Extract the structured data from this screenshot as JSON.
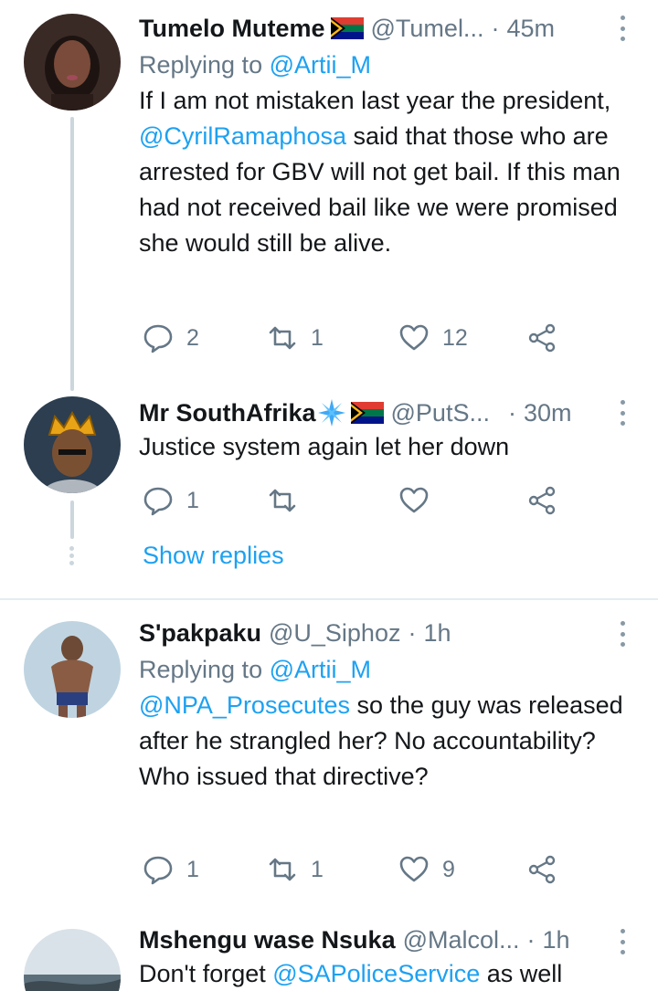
{
  "tweets": [
    {
      "name": "Tumelo Muteme",
      "handle": "@Tumel...",
      "sep": "·",
      "time": "45m",
      "reply_prefix": "Replying to ",
      "reply_to": "@Artii_M",
      "text_parts": [
        "If I am not mistaken last year the president, ",
        "@CyrilRamaphosa",
        " said that those who are arrested for GBV will not get bail. If this man had not received bail like we were promised she would still be alive."
      ],
      "replies": "2",
      "retweets": "1",
      "likes": "12"
    },
    {
      "name": "Mr SouthAfrika",
      "handle": "@PutS...",
      "sep": "·",
      "time": "30m",
      "text": "Justice system again let her down",
      "replies": "1",
      "retweets": "",
      "likes": ""
    },
    {
      "name": "S'pakpaku",
      "handle": "@U_Siphoz",
      "sep": "·",
      "time": "1h",
      "reply_prefix": "Replying to ",
      "reply_to": "@Artii_M",
      "text_mention": "@NPA_Prosecutes",
      "text_rest": " so the guy was released after he strangled her? No accountability? Who issued that directive?",
      "replies": "1",
      "retweets": "1",
      "likes": "9"
    },
    {
      "name": "Mshengu wase Nsuka",
      "handle": "@Malcol...",
      "sep": "·",
      "time": "1h",
      "text_prefix": "Don't forget ",
      "text_mention": "@SAPoliceService",
      "text_rest": " as well"
    }
  ],
  "show_replies": "Show replies",
  "icons": [
    "reply-icon",
    "retweet-icon",
    "like-icon",
    "share-icon",
    "more-icon",
    "sa-flag-icon",
    "sparkle-icon"
  ],
  "colors": {
    "link": "#1da1f2",
    "muted": "#657786",
    "divider": "#e6ecf0",
    "thread": "#ccd6dd"
  }
}
